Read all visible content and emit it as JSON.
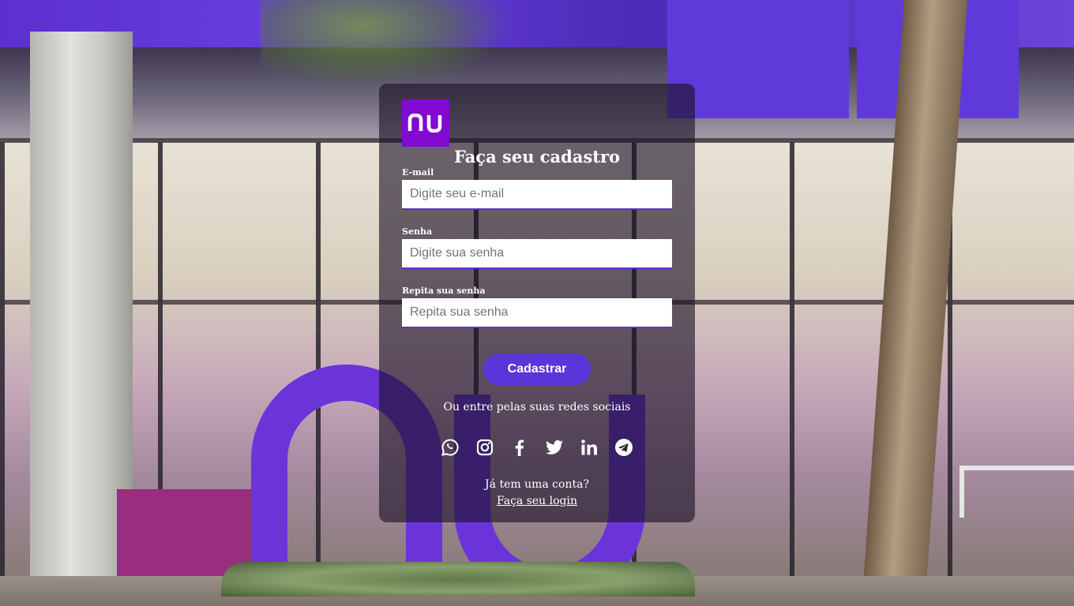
{
  "brand": {
    "logo_text": "nu",
    "logo_color": "#820ad1",
    "accent": "#5a35d8"
  },
  "form": {
    "title": "Faça seu cadastro",
    "email": {
      "label": "E-mail",
      "placeholder": "Digite seu e-mail",
      "value": ""
    },
    "password": {
      "label": "Senha",
      "placeholder": "Digite sua senha",
      "value": ""
    },
    "repeat_password": {
      "label": "Repita sua senha",
      "placeholder": "Repita sua senha",
      "value": ""
    },
    "submit_label": "Cadastrar"
  },
  "social": {
    "prompt": "Ou entre pelas suas redes sociais",
    "icons": [
      "whatsapp-icon",
      "instagram-icon",
      "facebook-icon",
      "twitter-icon",
      "linkedin-icon",
      "telegram-icon"
    ]
  },
  "account": {
    "question": "Já tem uma conta?",
    "login_link": "Faça seu login"
  }
}
